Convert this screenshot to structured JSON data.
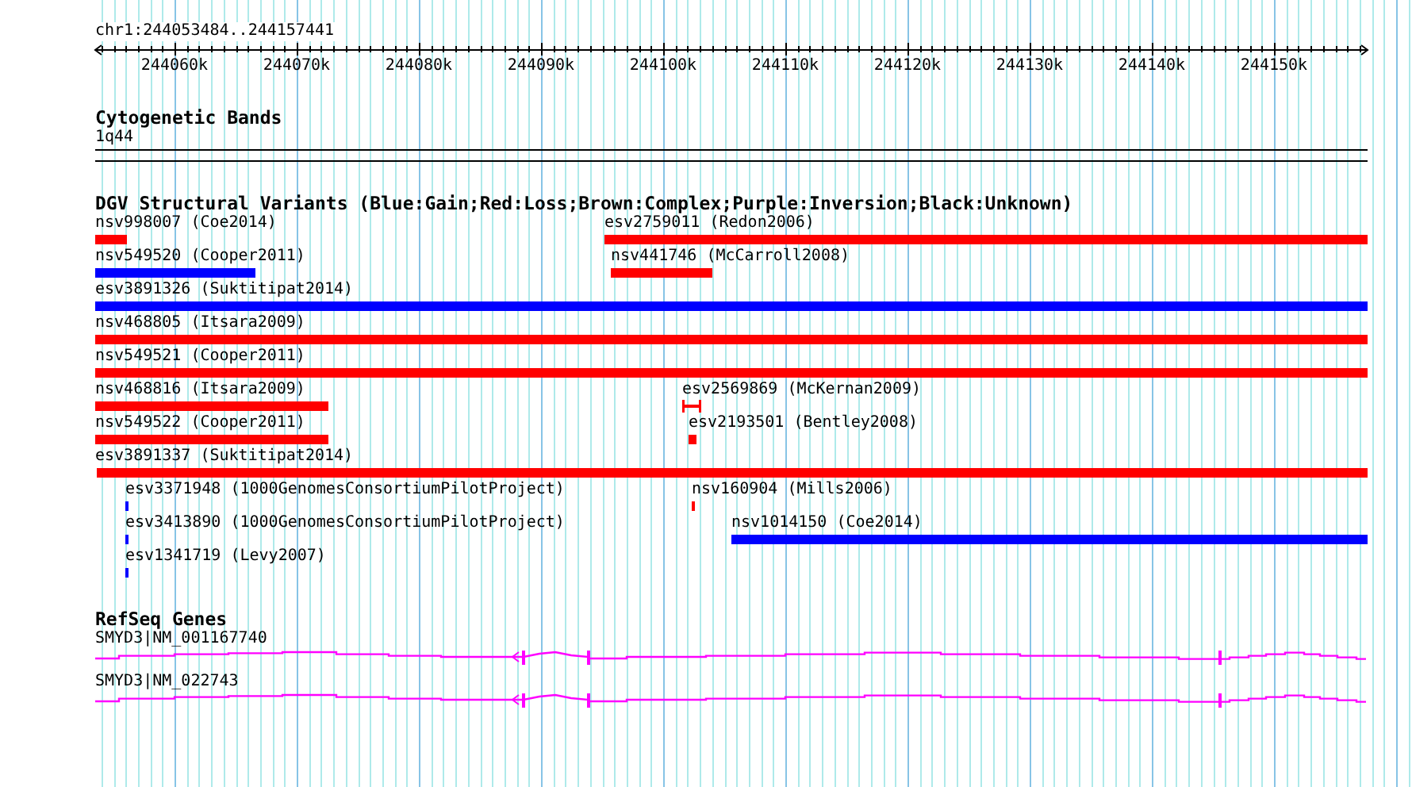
{
  "ruler": {
    "location": "chr1:244053484..244157441",
    "ticks": [
      "244060k",
      "244070k",
      "244080k",
      "244090k",
      "244100k",
      "244110k",
      "244120k",
      "244130k",
      "244140k",
      "244150k"
    ]
  },
  "cytogenetic_bands": {
    "title": "Cytogenetic Bands",
    "band": "1q44"
  },
  "dgv_variants": {
    "title": "DGV Structural Variants (Blue:Gain;Red:Loss;Brown:Complex;Purple:Inversion;Black:Unknown)",
    "rows": [
      {
        "features": [
          {
            "label": "nsv998007 (Coe2014)",
            "color": "#ff0000",
            "kind": "bar"
          },
          {
            "label": "esv2759011 (Redon2006)",
            "color": "#ff0000",
            "kind": "bar"
          }
        ]
      },
      {
        "features": [
          {
            "label": "nsv549520 (Cooper2011)",
            "color": "#0000ff",
            "kind": "bar"
          },
          {
            "label": "nsv441746 (McCarroll2008)",
            "color": "#ff0000",
            "kind": "bar"
          }
        ]
      },
      {
        "features": [
          {
            "label": "esv3891326 (Suktitipat2014)",
            "color": "#0000ff",
            "kind": "bar"
          }
        ]
      },
      {
        "features": [
          {
            "label": "nsv468805 (Itsara2009)",
            "color": "#ff0000",
            "kind": "bar"
          }
        ]
      },
      {
        "features": [
          {
            "label": "nsv549521 (Cooper2011)",
            "color": "#ff0000",
            "kind": "bar"
          }
        ]
      },
      {
        "features": [
          {
            "label": "nsv468816 (Itsara2009)",
            "color": "#ff0000",
            "kind": "bar"
          },
          {
            "label": "esv2569869 (McKernan2009)",
            "color": "#ff0000",
            "kind": "interval"
          }
        ]
      },
      {
        "features": [
          {
            "label": "nsv549522 (Cooper2011)",
            "color": "#ff0000",
            "kind": "bar"
          },
          {
            "label": "esv2193501 (Bentley2008)",
            "color": "#ff0000",
            "kind": "bar"
          }
        ]
      },
      {
        "features": [
          {
            "label": "esv3891337 (Suktitipat2014)",
            "color": "#ff0000",
            "kind": "bar"
          }
        ]
      },
      {
        "features": [
          {
            "label": "esv3371948 (1000GenomesConsortiumPilotProject)",
            "color": "#0000ff",
            "kind": "bar"
          },
          {
            "label": "nsv160904 (Mills2006)",
            "color": "#ff0000",
            "kind": "bar"
          }
        ]
      },
      {
        "features": [
          {
            "label": "esv3413890 (1000GenomesConsortiumPilotProject)",
            "color": "#0000ff",
            "kind": "bar"
          },
          {
            "label": "nsv1014150 (Coe2014)",
            "color": "#0000ff",
            "kind": "bar"
          }
        ]
      },
      {
        "features": [
          {
            "label": "esv1341719 (Levy2007)",
            "color": "#0000ff",
            "kind": "bar"
          }
        ]
      }
    ]
  },
  "refseq_genes": {
    "title": "RefSeq Genes",
    "genes": [
      {
        "label": "SMYD3|NM_001167740"
      },
      {
        "label": "SMYD3|NM_022743"
      }
    ]
  }
}
